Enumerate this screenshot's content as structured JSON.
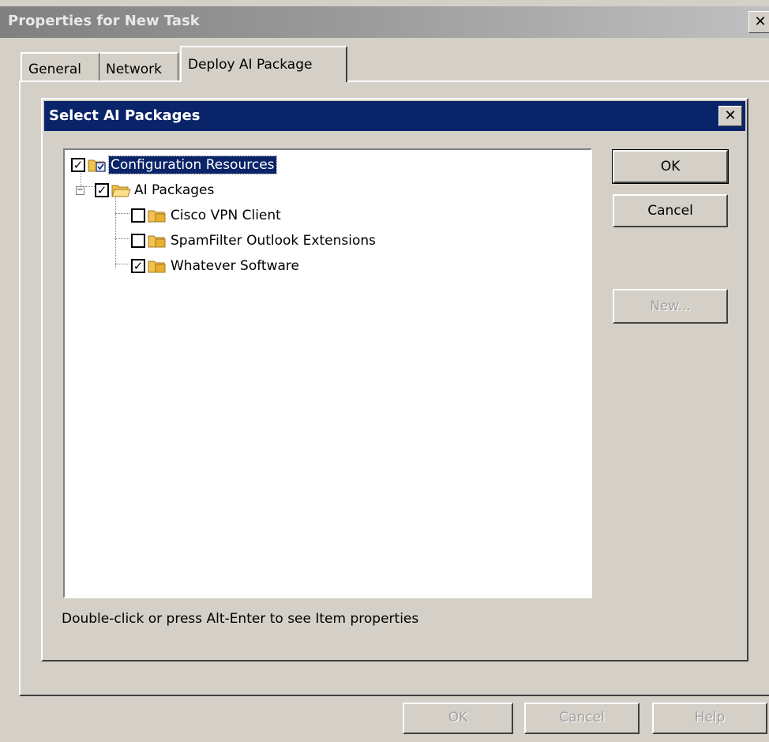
{
  "window": {
    "title": "Properties for New Task",
    "close_symbol": "✕"
  },
  "tabs": [
    {
      "label": "General",
      "active": false
    },
    {
      "label": "Network",
      "active": false
    },
    {
      "label": "Deploy AI Package",
      "active": true
    }
  ],
  "dialog": {
    "title": "Select AI Packages",
    "close_symbol": "✕",
    "tree": {
      "root": {
        "label": "Configuration Resources",
        "checked": true,
        "selected": true
      },
      "group": {
        "label": "AI Packages",
        "checked": true,
        "expanded": true,
        "expander_symbol": "−"
      },
      "items": [
        {
          "label": "Cisco VPN Client",
          "checked": false
        },
        {
          "label": "SpamFilter Outlook Extensions",
          "checked": false
        },
        {
          "label": "Whatever Software",
          "checked": true
        }
      ]
    },
    "buttons": {
      "ok": "OK",
      "cancel": "Cancel",
      "new": "New..."
    },
    "hint": "Double-click or press Alt-Enter to see Item properties"
  },
  "footer_buttons": {
    "ok": "OK",
    "cancel": "Cancel",
    "help": "Help"
  },
  "icons": {
    "checkmark": "✓",
    "folder_color": "#f2c14e"
  }
}
